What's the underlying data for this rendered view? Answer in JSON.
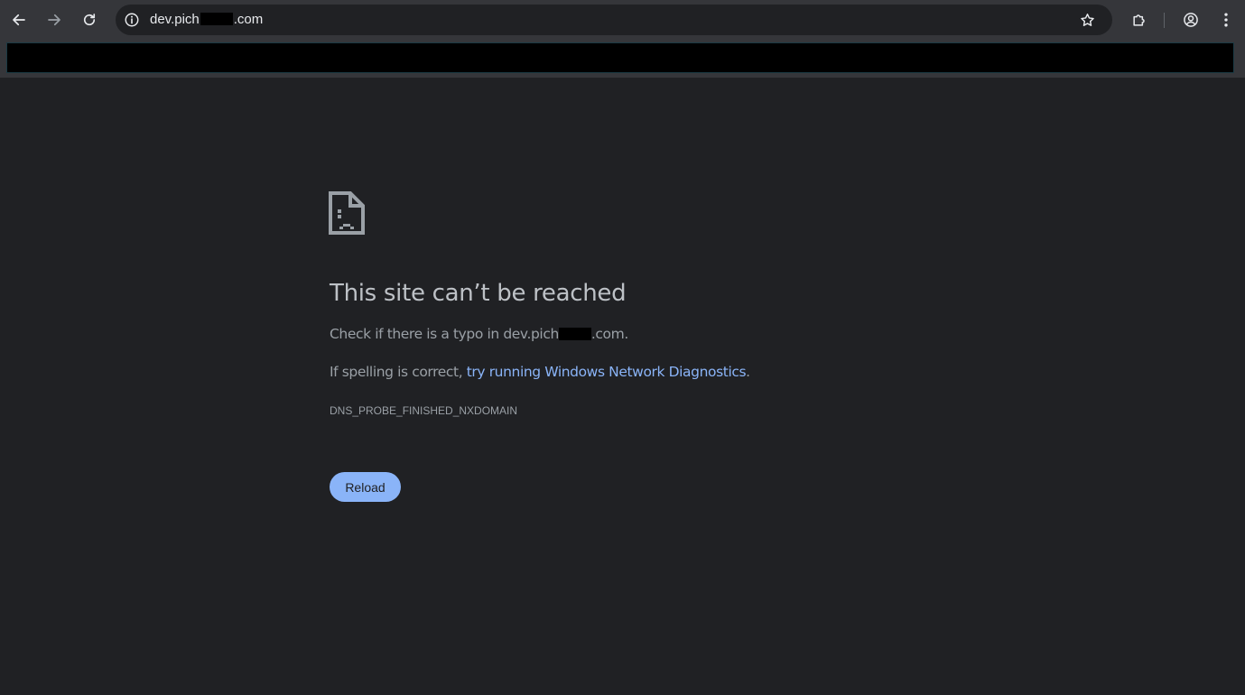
{
  "browser": {
    "url_prefix": "dev.pich",
    "url_suffix": ".com",
    "icons": {
      "back": "arrow-left-icon",
      "forward": "arrow-right-icon",
      "reload": "refresh-icon",
      "site_info": "info-icon",
      "bookmark": "star-icon",
      "extensions": "puzzle-icon",
      "profile": "account-circle-icon",
      "menu": "vertical-dots-icon"
    }
  },
  "error": {
    "title": "This site can’t be reached",
    "check_prefix": "Check if there is a typo in dev.pich",
    "check_suffix": ".com.",
    "spelling_prefix": "If spelling is correct, ",
    "diagnostics_link": "try running Windows Network Diagnostics",
    "spelling_suffix": ".",
    "code": "DNS_PROBE_FINISHED_NXDOMAIN",
    "reload_label": "Reload"
  },
  "colors": {
    "background": "#202124",
    "toolbar": "#35363a",
    "link": "#8ab4f8",
    "button": "#8ab4f8"
  }
}
